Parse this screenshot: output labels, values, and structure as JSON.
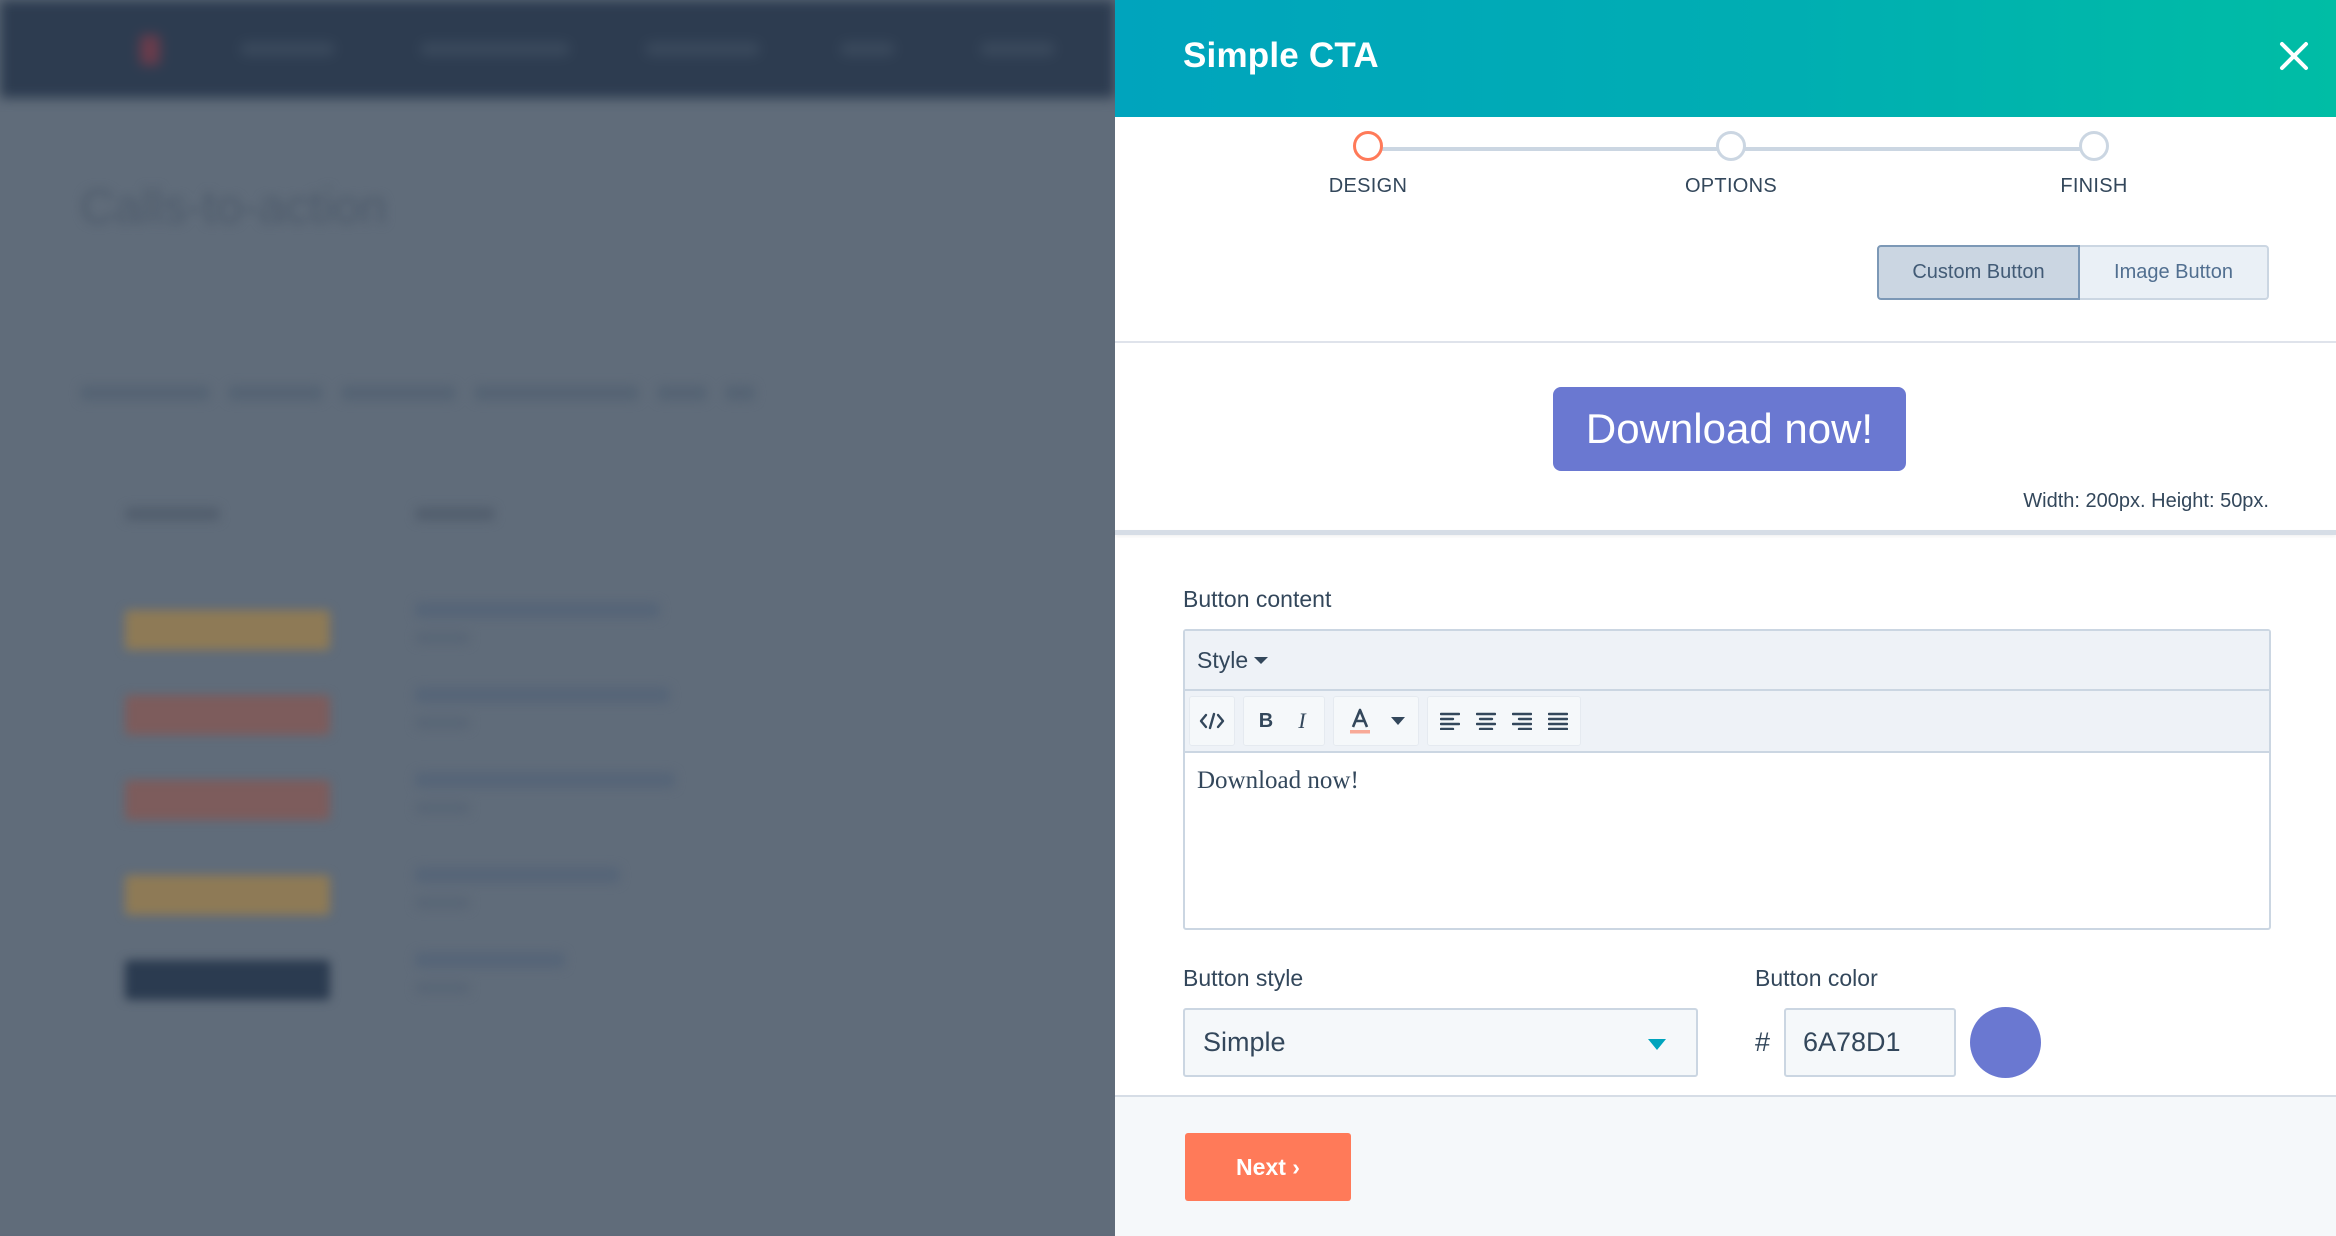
{
  "background": {
    "page_title": "Calls-to-action",
    "nav_item_count": 5,
    "row_thumbnail_colors": [
      "#8e7a56",
      "#7d5c5c",
      "#7d5c5c",
      "#8e7a56",
      "#2b3b50"
    ]
  },
  "panel": {
    "title": "Simple CTA",
    "close_icon": "close-icon",
    "steps": [
      {
        "label": "DESIGN",
        "active": true
      },
      {
        "label": "OPTIONS",
        "active": false
      },
      {
        "label": "FINISH",
        "active": false
      }
    ],
    "button_type": {
      "options": [
        "Custom Button",
        "Image Button"
      ],
      "selected": "Custom Button"
    },
    "preview": {
      "button_text": "Download now!",
      "dimensions": "Width: 200px. Height: 50px."
    },
    "button_content": {
      "label": "Button content",
      "style_dropdown": "Style",
      "toolbar": [
        "source-code-icon",
        "bold-icon",
        "italic-icon",
        "text-color-icon",
        "text-color-dropdown-icon",
        "align-left-icon",
        "align-center-icon",
        "align-right-icon",
        "align-justify-icon"
      ],
      "text": "Download now!"
    },
    "button_style": {
      "label": "Button style",
      "value": "Simple"
    },
    "button_color": {
      "label": "Button color",
      "hash": "#",
      "value": "6A78D1",
      "swatch": "#6A78D1"
    },
    "footer": {
      "next_label": "Next ›"
    }
  },
  "colors": {
    "accent_primary": "#ff7a59",
    "header_start": "#00a4bd",
    "header_end": "#00bda5",
    "cta_color": "#6A78D1"
  }
}
